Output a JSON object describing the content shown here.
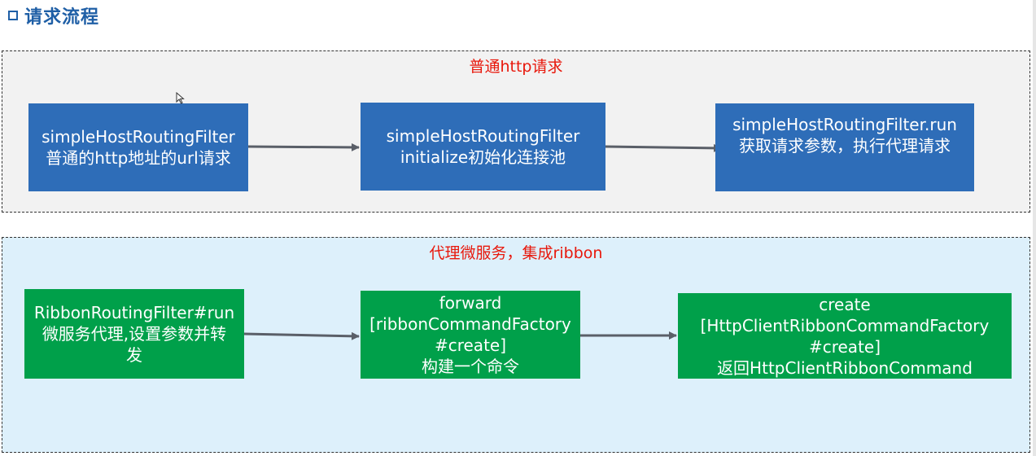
{
  "page_title": "请求流程",
  "colors": {
    "title": "#1f5fa6",
    "section_title": "#e8180c",
    "blue_box": "#2e6db8",
    "green_box": "#00a04a",
    "top_bg": "#f2f2f2",
    "bottom_bg": "#ddf0fb"
  },
  "sections": [
    {
      "title": "普通http请求",
      "boxes": [
        {
          "lines": [
            "simpleHostRoutingFilter",
            "普通的http地址的url请求"
          ]
        },
        {
          "lines": [
            "simpleHostRoutingFilter",
            "initialize初始化连接池"
          ]
        },
        {
          "lines": [
            "simpleHostRoutingFilter.run",
            "获取请求参数，执行代理请求"
          ]
        }
      ]
    },
    {
      "title": "代理微服务，集成ribbon",
      "boxes": [
        {
          "lines": [
            "RibbonRoutingFilter#run",
            "微服务代理,设置参数并转",
            "发"
          ]
        },
        {
          "lines": [
            "forward",
            "[ribbonCommandFactory",
            "#create]",
            "构建一个命令"
          ]
        },
        {
          "lines": [
            "create",
            "[HttpClientRibbonCommandFactory",
            "#create]",
            "返回HttpClientRibbonCommand"
          ]
        }
      ]
    }
  ]
}
